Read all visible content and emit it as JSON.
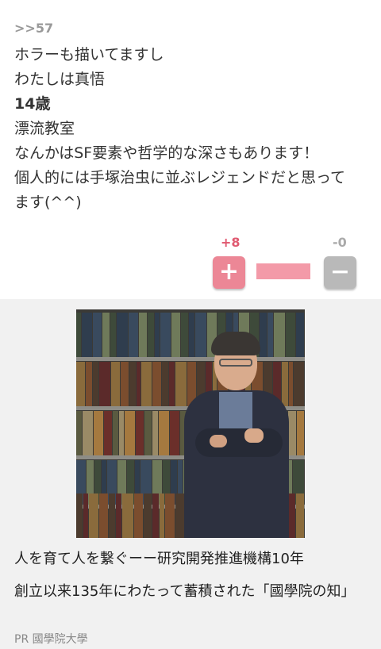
{
  "post": {
    "anchor": ">>57",
    "lines": [
      "ホラーも描いてますし",
      "わたしは真悟",
      "14歳",
      "漂流教室",
      "なんかはSF要素や哲学的な深さもあります！",
      "個人的には手塚治虫に並ぶレジェンドだと思って",
      "ます(^^)"
    ],
    "votes": {
      "plus_count": "+8",
      "minus_count": "-0",
      "plus_symbol": "+",
      "minus_symbol": "−",
      "plus_ratio": 1.0,
      "plus_color": "#ec8796",
      "minus_color": "#b9b9b9",
      "bar_color": "#f39aa8"
    }
  },
  "ad": {
    "image_icon": "photo-man-in-library",
    "title": "人を育て人を繋ぐーー研究開発推進機構10年",
    "description": "創立以来135年にわたって蓄積された「國學院の知」",
    "sponsor": "PR 國學院大學"
  }
}
